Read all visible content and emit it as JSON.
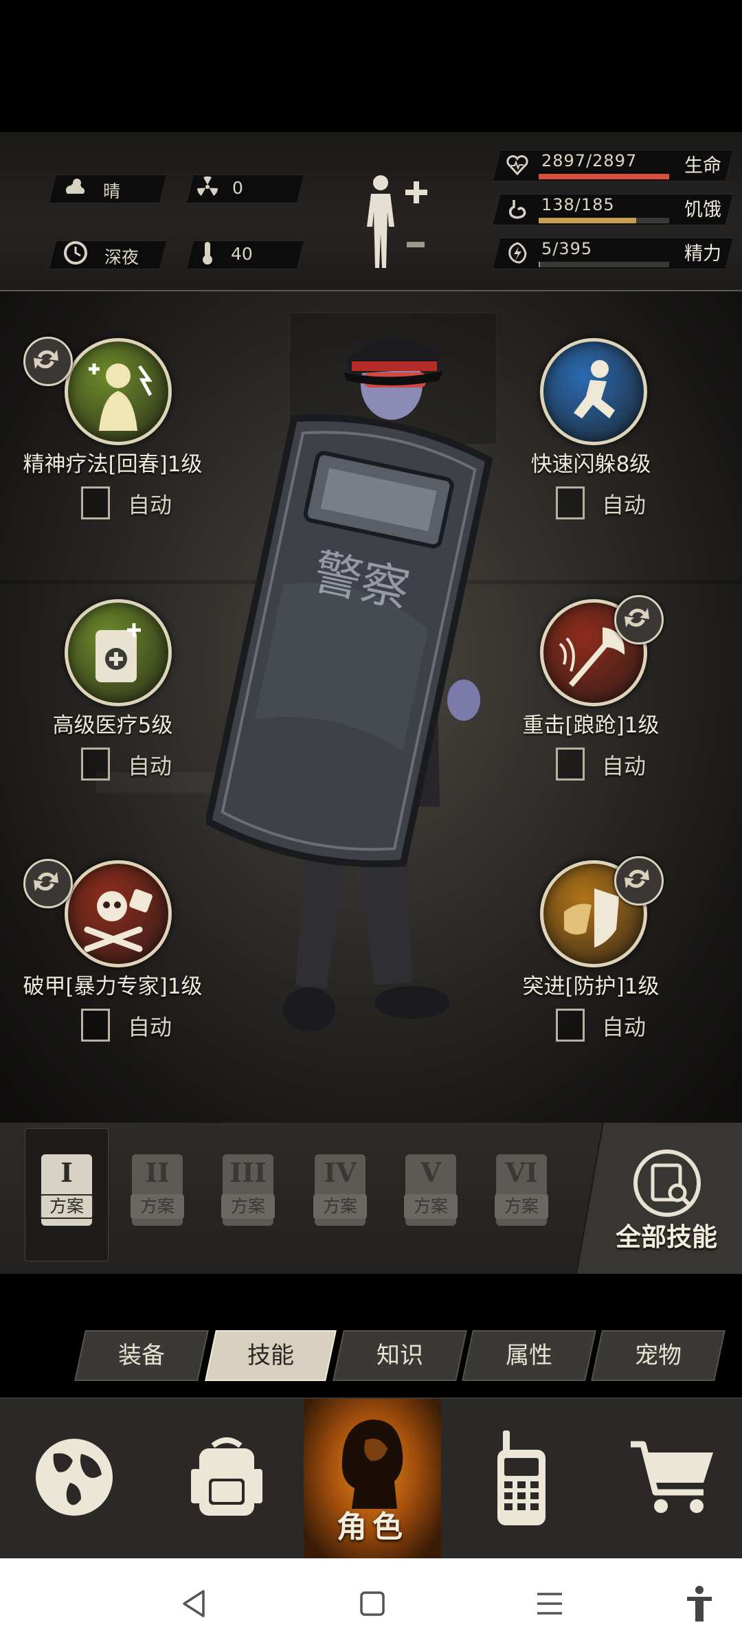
{
  "status": {
    "weather": "晴",
    "radiation": "0",
    "time_of_day": "深夜",
    "temperature": "40",
    "stats": [
      {
        "label": "生命",
        "value": "2897/2897",
        "fill": 1.0,
        "color": "#d9503f",
        "icon": "heart-icon"
      },
      {
        "label": "饥饿",
        "value": "138/185",
        "fill": 0.746,
        "color": "#c9a14e",
        "icon": "stomach-icon"
      },
      {
        "label": "精力",
        "value": "5/395",
        "fill": 0.013,
        "color": "#9a9690",
        "icon": "energy-icon"
      }
    ]
  },
  "skills": {
    "auto_label": "自动",
    "left": [
      {
        "name": "精神疗法[回春]1级",
        "icon": "meditation-icon",
        "orb_color": "#6e8a2a",
        "swap": true
      },
      {
        "name": "高级医疗5级",
        "icon": "medkit-icon",
        "orb_color": "#6e8a2a",
        "swap": false
      },
      {
        "name": "破甲[暴力专家]1级",
        "icon": "skull-dice-icon",
        "orb_color": "#8e2c1c",
        "swap": true
      }
    ],
    "right": [
      {
        "name": "快速闪躲8级",
        "icon": "dodge-icon",
        "orb_color": "#2a6ab0",
        "swap": false
      },
      {
        "name": "重击[踉跄]1级",
        "icon": "axe-icon",
        "orb_color": "#8e2c1c",
        "swap": true
      },
      {
        "name": "突进[防护]1级",
        "icon": "shield-charge-icon",
        "orb_color": "#b07418",
        "swap": true
      }
    ]
  },
  "plans": {
    "label": "方案",
    "numerals": [
      "I",
      "II",
      "III",
      "IV",
      "V",
      "VI"
    ],
    "active_index": 0,
    "all_skills_label": "全部技能"
  },
  "categories": {
    "items": [
      "装备",
      "技能",
      "知识",
      "属性",
      "宠物"
    ],
    "active_index": 1
  },
  "nav": {
    "role_label": "角色",
    "items": [
      "globe-icon",
      "backpack-icon",
      "role-icon",
      "walkie-talkie-icon",
      "cart-icon"
    ]
  },
  "character": {
    "shield_text": "警察"
  }
}
